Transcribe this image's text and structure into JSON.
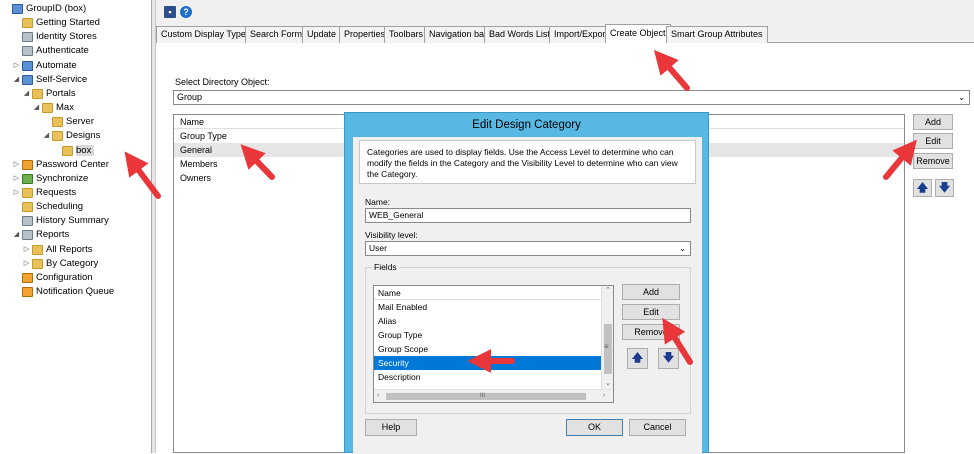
{
  "tree": {
    "items": [
      {
        "label": "GroupID (box)",
        "icon": "app-icon",
        "depth": 0,
        "expander": ""
      },
      {
        "label": "Getting Started",
        "icon": "folder-icon",
        "depth": 1,
        "expander": ""
      },
      {
        "label": "Identity Stores",
        "icon": "identity-stores-icon",
        "depth": 1,
        "expander": ""
      },
      {
        "label": "Authenticate",
        "icon": "authenticate-icon",
        "depth": 1,
        "expander": ""
      },
      {
        "label": "Automate",
        "icon": "automate-icon",
        "depth": 1,
        "expander": "▷"
      },
      {
        "label": "Self-Service",
        "icon": "self-service-icon",
        "depth": 1,
        "expander": "◢"
      },
      {
        "label": "Portals",
        "icon": "folder-icon",
        "depth": 2,
        "expander": "◢"
      },
      {
        "label": "Max",
        "icon": "folder-icon",
        "depth": 3,
        "expander": "◢"
      },
      {
        "label": "Server",
        "icon": "folder-icon",
        "depth": 4,
        "expander": ""
      },
      {
        "label": "Designs",
        "icon": "folder-icon",
        "depth": 4,
        "expander": "◢"
      },
      {
        "label": "box",
        "icon": "folder-icon",
        "depth": 5,
        "expander": ""
      },
      {
        "label": "Password Center",
        "icon": "password-center-icon",
        "depth": 1,
        "expander": "▷"
      },
      {
        "label": "Synchronize",
        "icon": "synchronize-icon",
        "depth": 1,
        "expander": "▷"
      },
      {
        "label": "Requests",
        "icon": "folder-icon",
        "depth": 1,
        "expander": "▷"
      },
      {
        "label": "Scheduling",
        "icon": "folder-icon",
        "depth": 1,
        "expander": ""
      },
      {
        "label": "History Summary",
        "icon": "history-icon",
        "depth": 1,
        "expander": ""
      },
      {
        "label": "Reports",
        "icon": "reports-icon",
        "depth": 1,
        "expander": "◢"
      },
      {
        "label": "All Reports",
        "icon": "folder-icon",
        "depth": 2,
        "expander": "▷"
      },
      {
        "label": "By Category",
        "icon": "folder-icon",
        "depth": 2,
        "expander": "▷"
      },
      {
        "label": "Configuration",
        "icon": "configuration-icon",
        "depth": 1,
        "expander": ""
      },
      {
        "label": "Notification Queue",
        "icon": "notification-queue-icon",
        "depth": 1,
        "expander": ""
      }
    ],
    "selected_index": 10
  },
  "toolbar": {
    "save_icon": "save-icon",
    "help_icon": "help-icon",
    "save_glyph": "▪",
    "help_glyph": "?"
  },
  "tabs": [
    {
      "label": "Custom Display Types"
    },
    {
      "label": "Search Forms"
    },
    {
      "label": "Update"
    },
    {
      "label": "Properties"
    },
    {
      "label": "Toolbars"
    },
    {
      "label": "Navigation bar"
    },
    {
      "label": "Bad Words List"
    },
    {
      "label": "Import/Export"
    },
    {
      "label": "Create Object",
      "active": true
    },
    {
      "label": "Smart Group Attributes"
    }
  ],
  "panel": {
    "select_label": "Select Directory Object:",
    "select_value": "Group",
    "list_header": "Name",
    "categories": [
      "Group Type",
      "General",
      "Members",
      "Owners"
    ],
    "selected_category": "General",
    "buttons": {
      "add": "Add",
      "edit": "Edit",
      "remove": "Remove"
    },
    "move_up_glyph": "🡅",
    "move_down_glyph": "🡇"
  },
  "dialog": {
    "title": "Edit Design Category",
    "description": "Categories are used to display fields.  Use the Access Level to determine who can modify the fields in the Category and the Visibility Level to determine who can view the Category.",
    "name_label": "Name:",
    "name_value": "WEB_General",
    "visibility_label": "Visibility level:",
    "visibility_value": "User",
    "fields_label": "Fields",
    "fields_header": "Name",
    "fields": [
      "Mail Enabled",
      "Alias",
      "Group Type",
      "Group Scope",
      "Security",
      "Description"
    ],
    "selected_field": "Security",
    "buttons": {
      "add": "Add",
      "edit": "Edit",
      "remove": "Remove",
      "help": "Help",
      "ok": "OK",
      "cancel": "Cancel"
    },
    "move_up_glyph": "🡅",
    "move_down_glyph": "🡇",
    "hscroll_mid_glyph": "III",
    "vscroll_mid_glyph": "≡"
  },
  "colors": {
    "dialog_frame": "#58b8e4",
    "selection": "#0078d7",
    "annotation_arrow": "#e8363a",
    "arrow_button_glyph": "#1a3d8f"
  }
}
